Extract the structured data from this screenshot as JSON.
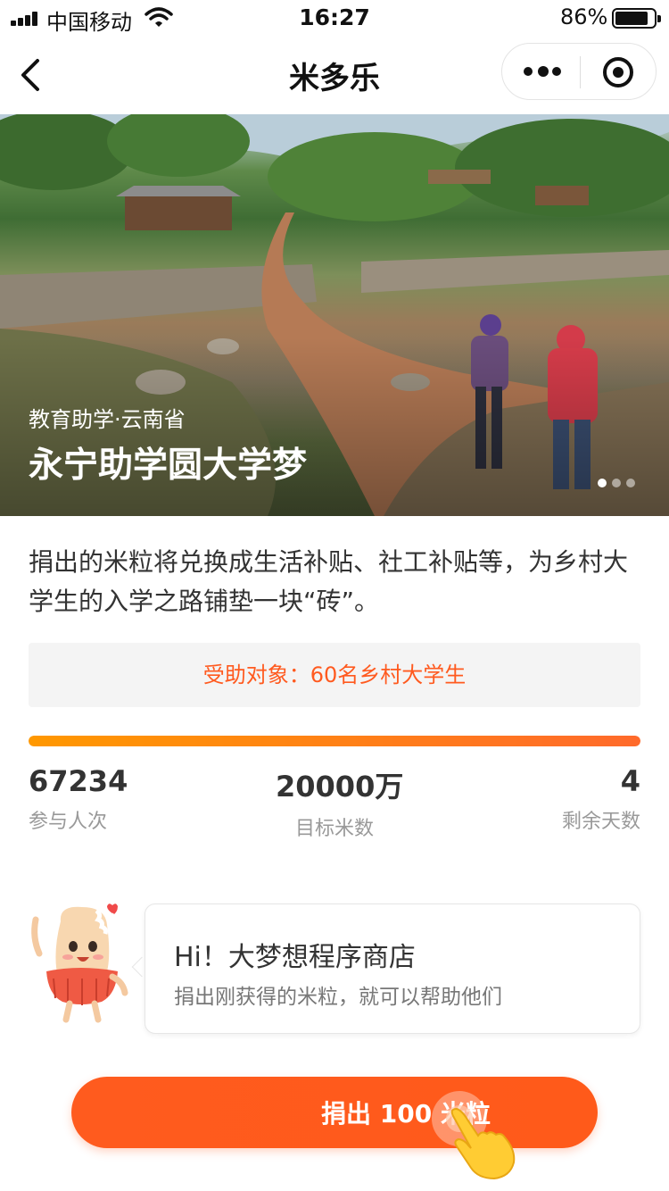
{
  "status_bar": {
    "carrier": "中国移动",
    "time": "16:27",
    "battery_percent": "86%",
    "battery_level": 0.86
  },
  "nav": {
    "title": "米多乐",
    "back_icon": "chevron-left-icon",
    "more_icon": "more-dots-icon",
    "close_icon": "target-circle-icon"
  },
  "hero": {
    "category": "教育助学·云南省",
    "title": "永宁助学圆大学梦",
    "carousel_pages": 3,
    "carousel_active": 1
  },
  "project": {
    "description": "捐出的米粒将兑换成生活补贴、社工补贴等，为乡村大学生的入学之路铺垫一块“砖”。",
    "beneficiary": "受助对象：60名乡村大学生",
    "progress": 1.0,
    "stats": [
      {
        "value": "67234",
        "label": "参与人次"
      },
      {
        "value": "20000万",
        "label": "目标米数"
      },
      {
        "value": "4",
        "label": "剩余天数"
      }
    ]
  },
  "bubble": {
    "title": "Hi！大梦想程序商店",
    "subtitle": "捐出刚获得的米粒，就可以帮助他们"
  },
  "donate": {
    "label": "捐出 100 米粒",
    "hand_icon": "tap-hand-icon"
  },
  "colors": {
    "accent": "#ff5a1f",
    "progress_start": "#ff9800",
    "progress_end": "#ff6a2b"
  }
}
